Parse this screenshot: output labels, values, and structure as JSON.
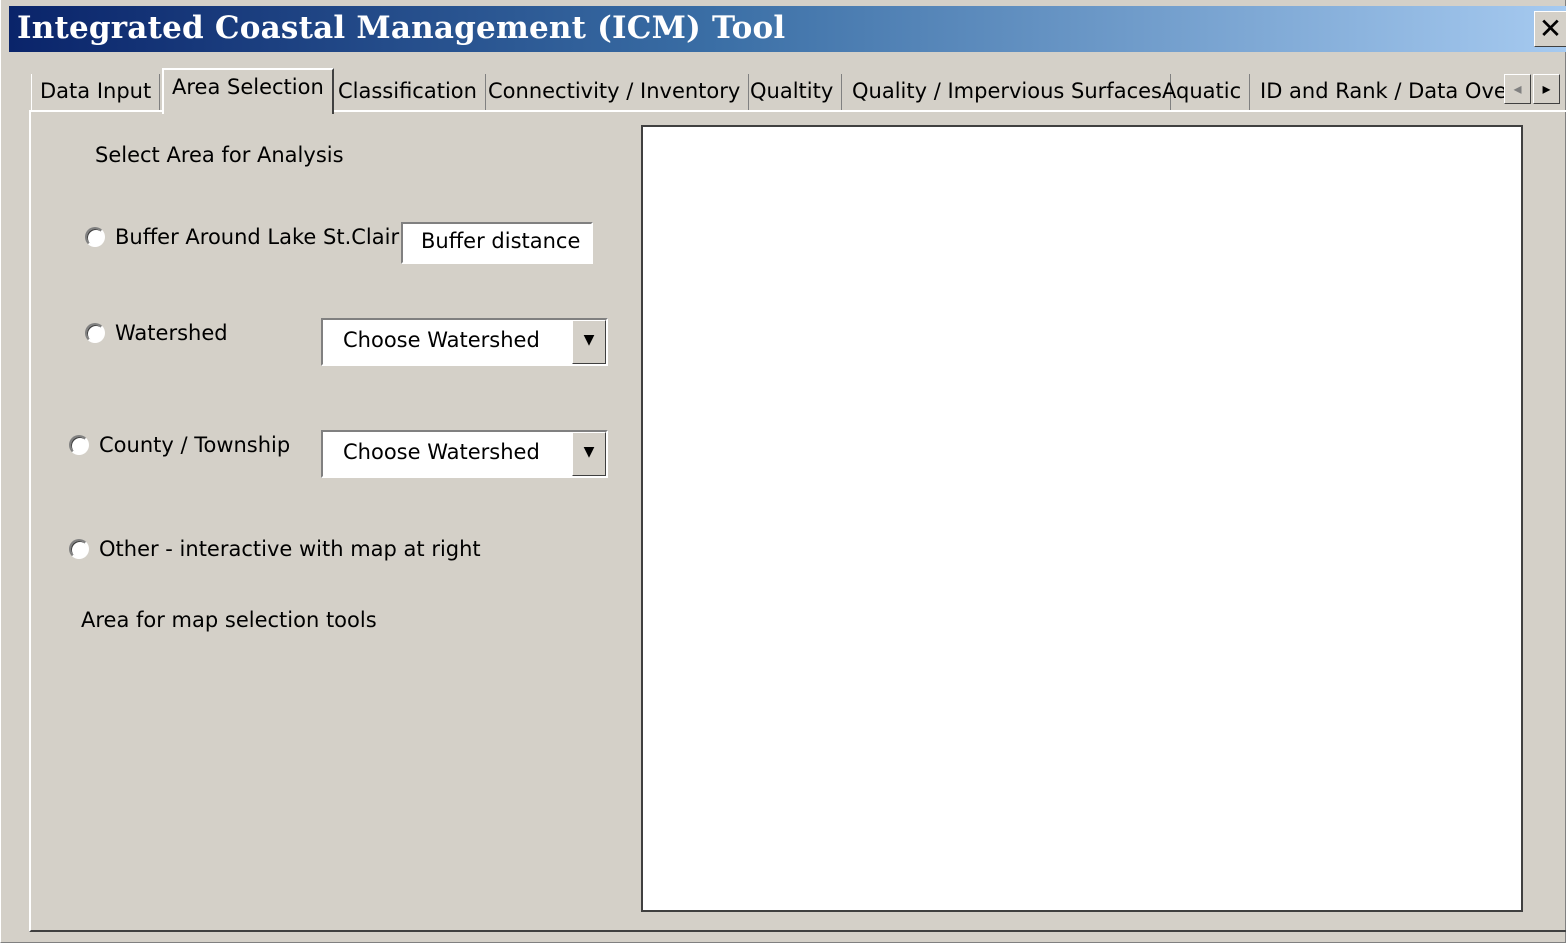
{
  "window": {
    "title": "Integrated Coastal Management (ICM) Tool",
    "close_label": "✕",
    "title_gradient": [
      "#0a246a",
      "#a6caf0"
    ]
  },
  "tabs": [
    {
      "label": "Data Input",
      "active": false
    },
    {
      "label": "Area Selection",
      "active": true
    },
    {
      "label": "Classification",
      "active": false
    },
    {
      "label": "Connectivity / Inventory",
      "active": false
    },
    {
      "label": "Qualtity",
      "active": false
    },
    {
      "label": "Quality / Impervious Surfaces",
      "active": false
    },
    {
      "label": "Aquatic",
      "active": false
    },
    {
      "label": "ID and Rank / Data Over",
      "active": false
    }
  ],
  "tab_scroll": {
    "left_icon": "◂",
    "right_icon": "▸"
  },
  "area_selection": {
    "heading": "Select Area for Analysis",
    "options": {
      "buffer": {
        "label": "Buffer Around Lake St.Clair",
        "selected": false
      },
      "watershed": {
        "label": "Watershed",
        "selected": false
      },
      "county": {
        "label": "County / Township",
        "selected": false
      },
      "other": {
        "label": "Other - interactive with map at right",
        "selected": false
      }
    },
    "buffer_distance": "Buffer distance",
    "watershed_select": {
      "value": "Choose Watershed",
      "arrow": "▼"
    },
    "county_select": {
      "value": "Choose Watershed",
      "arrow": "▼"
    },
    "map_tools_label": "Area for map selection tools"
  }
}
